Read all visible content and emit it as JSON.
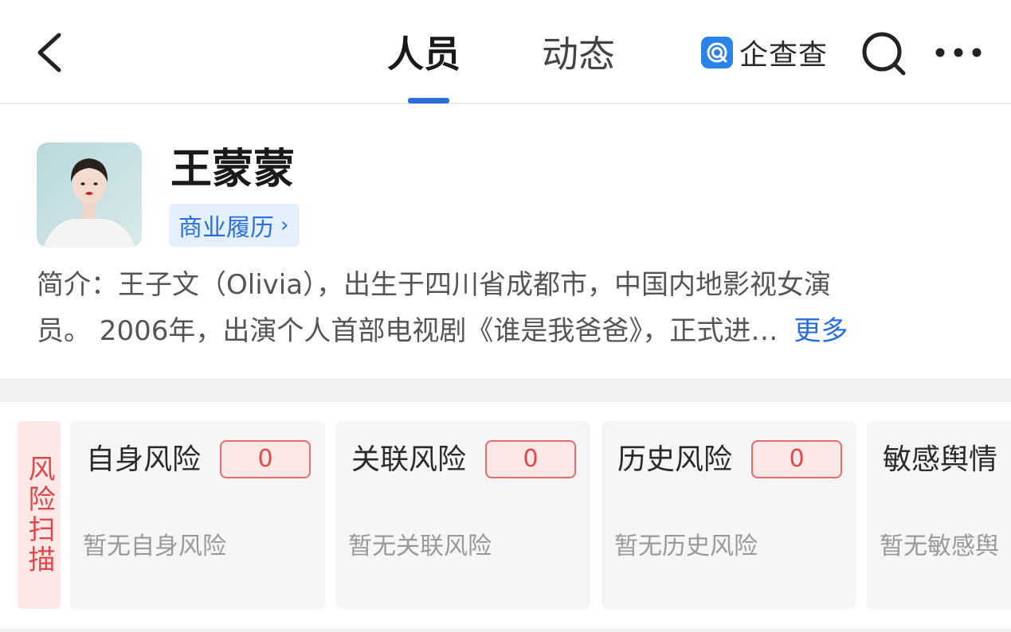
{
  "header": {
    "tabs": [
      {
        "label": "人员",
        "active": true
      },
      {
        "label": "动态",
        "active": false
      }
    ],
    "brand": "企查查",
    "accent_color": "#2b6fd6"
  },
  "profile": {
    "name": "王蒙蒙",
    "career_tag": "商业履历",
    "bio_line1": "简介：王子文（Olivia），出生于四川省成都市，中国内地影视女演",
    "bio_line2": "员。 2006年，出演个人首部电视剧《谁是我爸爸》，正式进…",
    "more_label": "更多"
  },
  "risk": {
    "scan_label": "风险扫描",
    "cards": [
      {
        "title": "自身风险",
        "count": "0",
        "empty_text": "暂无自身风险"
      },
      {
        "title": "关联风险",
        "count": "0",
        "empty_text": "暂无关联风险"
      },
      {
        "title": "历史风险",
        "count": "0",
        "empty_text": "暂无历史风险"
      },
      {
        "title": "敏感舆情",
        "count": "",
        "empty_text": "暂无敏感舆"
      }
    ],
    "alert_color": "#e04848"
  }
}
